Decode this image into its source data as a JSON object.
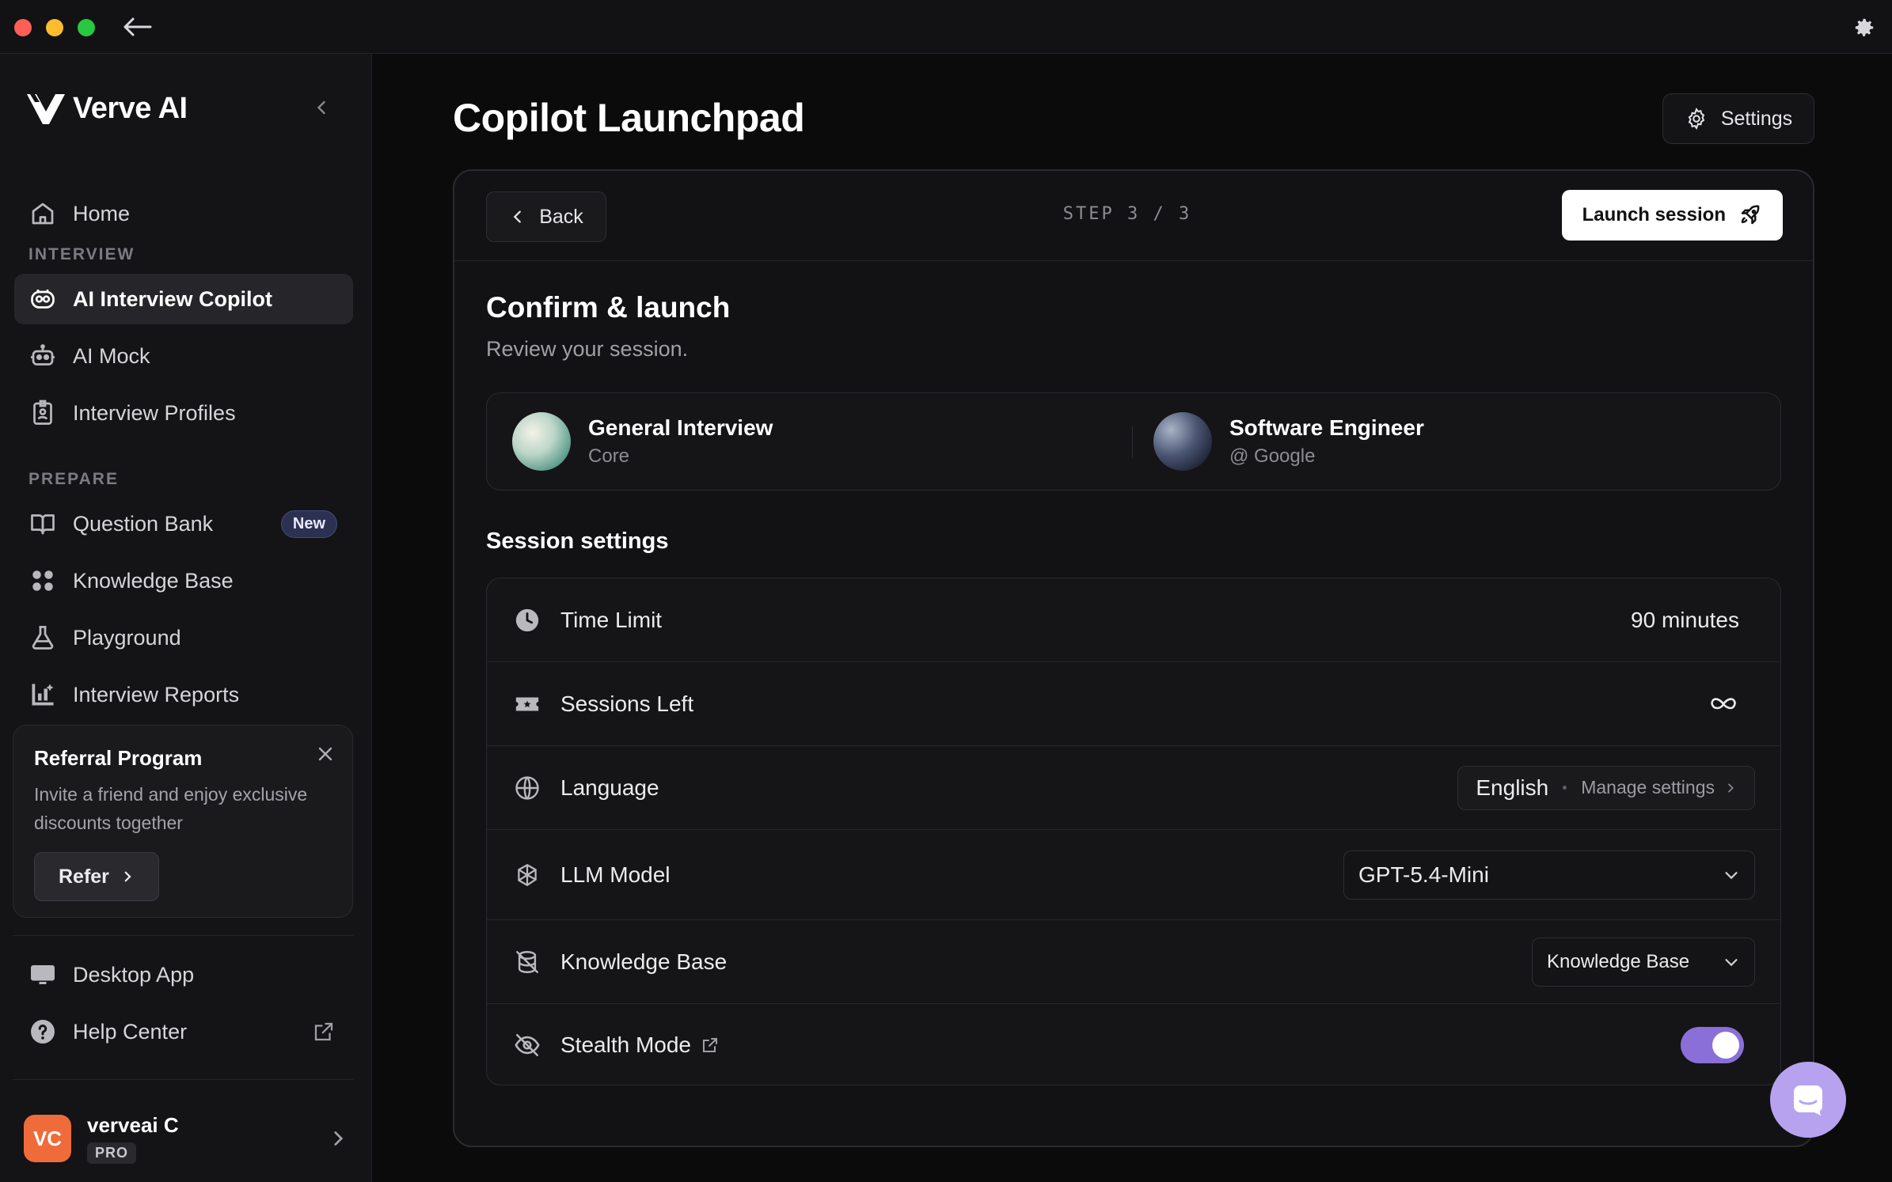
{
  "window": {
    "back_icon": "arrow-left-icon",
    "settings_icon": "gear-icon"
  },
  "sidebar": {
    "brand": "Verve AI",
    "home_label": "Home",
    "section_interview": "INTERVIEW",
    "interview_items": [
      {
        "label": "AI Interview Copilot",
        "icon": "copilot-icon",
        "active": true
      },
      {
        "label": "AI Mock",
        "icon": "robot-icon"
      },
      {
        "label": "Interview Profiles",
        "icon": "badge-icon"
      }
    ],
    "section_prepare": "PREPARE",
    "prepare_items": [
      {
        "label": "Question Bank",
        "icon": "book-icon",
        "badge": "New"
      },
      {
        "label": "Knowledge Base",
        "icon": "grid-dots-icon"
      },
      {
        "label": "Playground",
        "icon": "flask-icon"
      },
      {
        "label": "Interview Reports",
        "icon": "chart-icon"
      }
    ],
    "referral": {
      "title": "Referral Program",
      "description": "Invite a friend and enjoy exclusive discounts together",
      "button": "Refer"
    },
    "bottom_items": [
      {
        "label": "Desktop App",
        "icon": "monitor-icon"
      },
      {
        "label": "Help Center",
        "icon": "help-icon"
      }
    ],
    "profile": {
      "initials": "VC",
      "name": "verveai C",
      "plan": "PRO"
    }
  },
  "main": {
    "title": "Copilot Launchpad",
    "settings_button": "Settings",
    "card": {
      "back_button": "Back",
      "step": "STEP 3 / 3",
      "launch_button": "Launch session",
      "confirm_title": "Confirm & launch",
      "confirm_subtitle": "Review your session.",
      "summary": [
        {
          "title": "General Interview",
          "subtitle": "Core"
        },
        {
          "title": "Software Engineer",
          "subtitle": "@ Google"
        }
      ],
      "session_settings_title": "Session settings",
      "settings": {
        "time_limit": {
          "label": "Time Limit",
          "value": "90 minutes"
        },
        "sessions_left": {
          "label": "Sessions Left",
          "value_icon": "infinity-icon"
        },
        "language": {
          "label": "Language",
          "value": "English",
          "manage": "Manage settings"
        },
        "llm_model": {
          "label": "LLM Model",
          "value": "GPT-5.4-Mini"
        },
        "knowledge_base": {
          "label": "Knowledge Base",
          "value": "Knowledge Base"
        },
        "stealth_mode": {
          "label": "Stealth Mode",
          "enabled": true
        }
      }
    }
  },
  "colors": {
    "accent_toggle": "#8b6fd8",
    "chat_fab": "#b7a2f0",
    "avatar": "#f06b3a",
    "badge_new_bg": "#2c3152"
  }
}
